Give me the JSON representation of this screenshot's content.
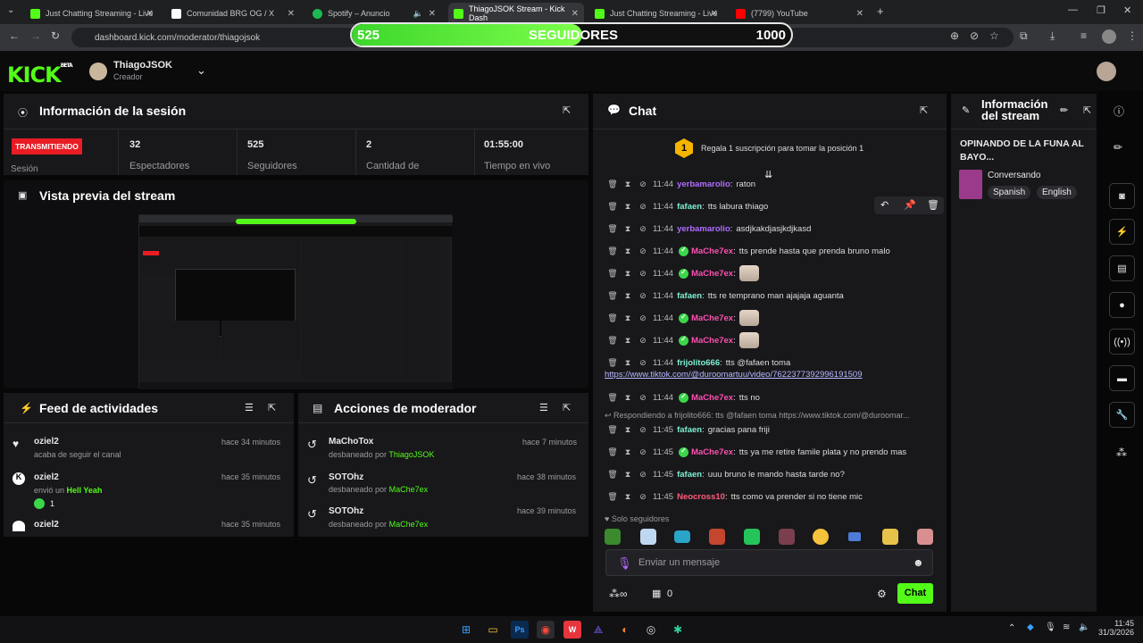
{
  "browser": {
    "tabs": [
      {
        "label": "Just Chatting Streaming - Live",
        "color": "#53fc18"
      },
      {
        "label": "Comunidad BRG OG / X",
        "color": "#ffffff"
      },
      {
        "label": "Spotify – Anuncio",
        "color": "#1db954"
      },
      {
        "label": "ThiagoJSOK Stream - Kick Dash",
        "color": "#53fc18"
      },
      {
        "label": "Just Chatting Streaming - Live",
        "color": "#53fc18"
      },
      {
        "label": "(7799) YouTube",
        "color": "#ff0000"
      }
    ],
    "url": "dashboard.kick.com/moderator/thiagojsok"
  },
  "follow_goal": {
    "current": "525",
    "label": "SEGUIDORES",
    "target": "1000",
    "progress": 0.525
  },
  "header": {
    "logo": "KICK",
    "beta": "BETA",
    "username": "ThiagoJSOK",
    "role": "Creador"
  },
  "session": {
    "title": "Información de la sesión",
    "status": "TRANSMITIENDO",
    "session_label": "Sesión",
    "stats": [
      {
        "value": "32",
        "label": "Espectadores"
      },
      {
        "value": "525",
        "label": "Seguidores"
      },
      {
        "value": "2",
        "label": "Cantidad de"
      },
      {
        "value": "01:55:00",
        "label": "Tiempo en vivo"
      }
    ]
  },
  "preview": {
    "title": "Vista previa del stream"
  },
  "feed": {
    "title": "Feed de actividades",
    "items": [
      {
        "user": "oziel2",
        "time": "hace 34 minutos",
        "text": "acaba de seguir el canal"
      },
      {
        "user": "oziel2",
        "time": "hace 35 minutos",
        "text": "envió un",
        "highlight": "Hell Yeah",
        "count": "1"
      },
      {
        "user": "oziel2",
        "time": "hace 35 minutos",
        "text": ""
      }
    ]
  },
  "modactions": {
    "title": "Acciones de moderador",
    "items": [
      {
        "user": "MaChoTox",
        "time": "hace 7 minutos",
        "text": "desbaneado por",
        "by": "ThiagoJSOK"
      },
      {
        "user": "SOTOhz",
        "time": "hace 38 minutos",
        "text": "desbaneado por",
        "by": "MaChe7ex"
      },
      {
        "user": "SOTOhz",
        "time": "hace 39 minutos",
        "text": "desbaneado por",
        "by": "MaChe7ex"
      }
    ]
  },
  "chat": {
    "title": "Chat",
    "pinned": "Regala 1 suscripción para tomar la posición 1",
    "pinned_rank": "1",
    "messages": [
      {
        "time": "11:44",
        "user": "yerbamarolio",
        "color": "#b06cff",
        "text": "raton",
        "badge": false
      },
      {
        "time": "11:44",
        "user": "fafaen",
        "color": "#7ef0d2",
        "text": "tts labura thiago",
        "badge": false
      },
      {
        "time": "11:44",
        "user": "yerbamarolio",
        "color": "#b06cff",
        "text": "asdjkakdjasjkdjkasd",
        "badge": false
      },
      {
        "time": "11:44",
        "user": "MaChe7ex",
        "color": "#ff4fb0",
        "text": "tts prende hasta que prenda bruno malo",
        "badge": true
      },
      {
        "time": "11:44",
        "user": "MaChe7ex",
        "color": "#ff4fb0",
        "text": "",
        "badge": true,
        "emote": true
      },
      {
        "time": "11:44",
        "user": "fafaen",
        "color": "#7ef0d2",
        "text": "tts re temprano man ajajaja aguanta",
        "badge": false
      },
      {
        "time": "11:44",
        "user": "MaChe7ex",
        "color": "#ff4fb0",
        "text": "",
        "badge": true,
        "emote": true
      },
      {
        "time": "11:44",
        "user": "MaChe7ex",
        "color": "#ff4fb0",
        "text": "",
        "badge": true,
        "emote": true
      },
      {
        "time": "11:44",
        "user": "frijolito666",
        "color": "#7ef0d2",
        "text": "tts @fafaen toma",
        "badge": false
      },
      {
        "time": "11:44",
        "user": "MaChe7ex",
        "color": "#ff4fb0",
        "text": "tts no",
        "badge": true
      }
    ],
    "link": "https://www.tiktok.com/@duroomartuu/video/7622377392996191509",
    "reply": "Respondiendo a frijolito666: tts @fafaen toma https://www.tiktok.com/@duroomar...",
    "messages2": [
      {
        "time": "11:45",
        "user": "fafaen",
        "color": "#7ef0d2",
        "text": "gracias pana friji",
        "badge": false
      },
      {
        "time": "11:45",
        "user": "MaChe7ex",
        "color": "#ff4fb0",
        "text": "tts ya me retire famile plata y no prendo mas",
        "badge": true
      },
      {
        "time": "11:45",
        "user": "fafaen",
        "color": "#7ef0d2",
        "text": "uuu bruno le mando hasta tarde no?",
        "badge": false
      },
      {
        "time": "11:45",
        "user": "Neocross10",
        "color": "#ff5b7a",
        "text": "tts como va prender si no tiene mic",
        "badge": false
      }
    ],
    "followers_only": "Solo seguidores",
    "placeholder": "Enviar un mensaje",
    "count": "0",
    "send": "Chat"
  },
  "streaminfo": {
    "title": "Información del stream",
    "stream_title": "OPINANDO DE LA FUNA AL BAYO...",
    "category": "Conversando",
    "tags": [
      "Spanish",
      "English"
    ]
  },
  "taskbar": {
    "time": "11:45",
    "date": "31/3/2026"
  }
}
